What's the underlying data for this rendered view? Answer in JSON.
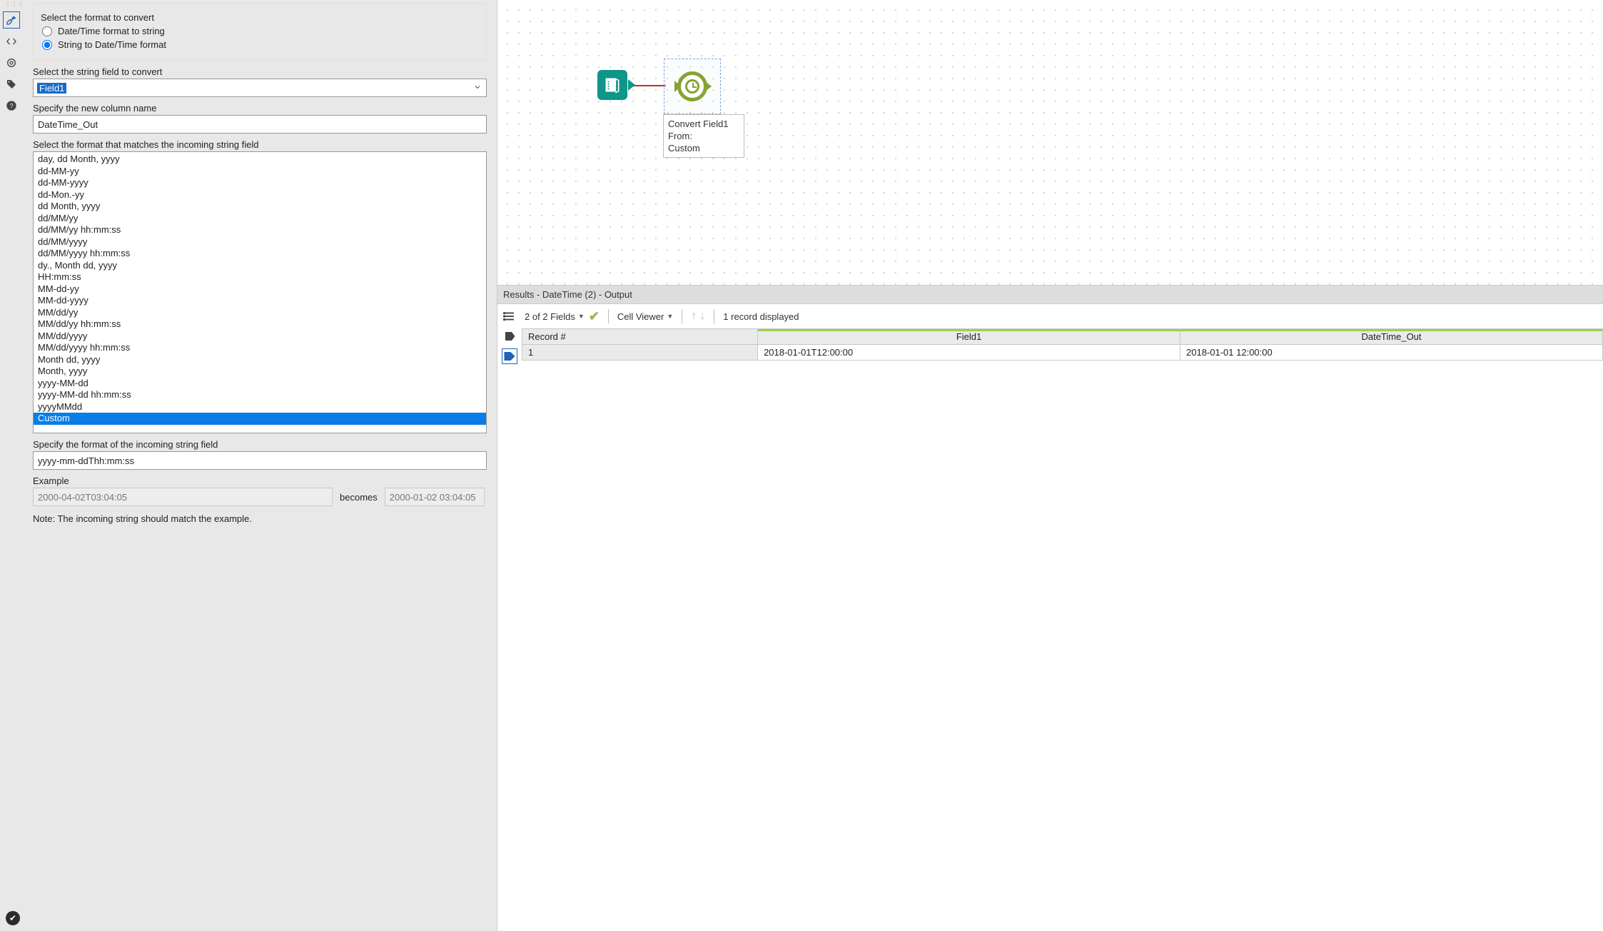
{
  "icon_rail": {
    "wrench": "configure-icon",
    "xml": "xml-icon",
    "target": "annotation-icon",
    "tag": "tag-icon",
    "help": "help-icon"
  },
  "config": {
    "select_format_label": "Select the format to convert",
    "opt_dt_to_string": "Date/Time format to string",
    "opt_string_to_dt": "String to Date/Time format",
    "select_string_field_label": "Select the string field to convert",
    "field_dropdown_value": "Field1",
    "new_col_label": "Specify the new column name",
    "new_col_value": "DateTime_Out",
    "format_list_label": "Select the format that matches the incoming string field",
    "formats": [
      "day, dd Month, yyyy",
      "dd-MM-yy",
      "dd-MM-yyyy",
      "dd-Mon.-yy",
      "dd Month, yyyy",
      "dd/MM/yy",
      "dd/MM/yy hh:mm:ss",
      "dd/MM/yyyy",
      "dd/MM/yyyy hh:mm:ss",
      "dy., Month dd, yyyy",
      "HH:mm:ss",
      "MM-dd-yy",
      "MM-dd-yyyy",
      "MM/dd/yy",
      "MM/dd/yy hh:mm:ss",
      "MM/dd/yyyy",
      "MM/dd/yyyy hh:mm:ss",
      "Month dd, yyyy",
      "Month, yyyy",
      "yyyy-MM-dd",
      "yyyy-MM-dd hh:mm:ss",
      "yyyyMMdd",
      "Custom"
    ],
    "format_selected": "Custom",
    "specify_format_label": "Specify the format of the incoming string field",
    "specify_format_value": "yyyy-mm-ddThh:mm:ss",
    "example_label": "Example",
    "example_input": "2000-04-02T03:04:05",
    "becomes_label": "becomes",
    "example_output": "2000-01-02 03:04:05",
    "note_text": "Note: The incoming string should match the example."
  },
  "canvas": {
    "node_label_line1": "Convert Field1",
    "node_label_line2": "From:",
    "node_label_line3": "Custom"
  },
  "results": {
    "header": "Results - DateTime (2) - Output",
    "fields_text": "2 of 2 Fields",
    "cell_viewer": "Cell Viewer",
    "records_text": "1 record displayed",
    "col_record": "Record #",
    "col_field1": "Field1",
    "col_out": "DateTime_Out",
    "row1_num": "1",
    "row1_field1": "2018-01-01T12:00:00",
    "row1_out": "2018-01-01 12:00:00"
  }
}
